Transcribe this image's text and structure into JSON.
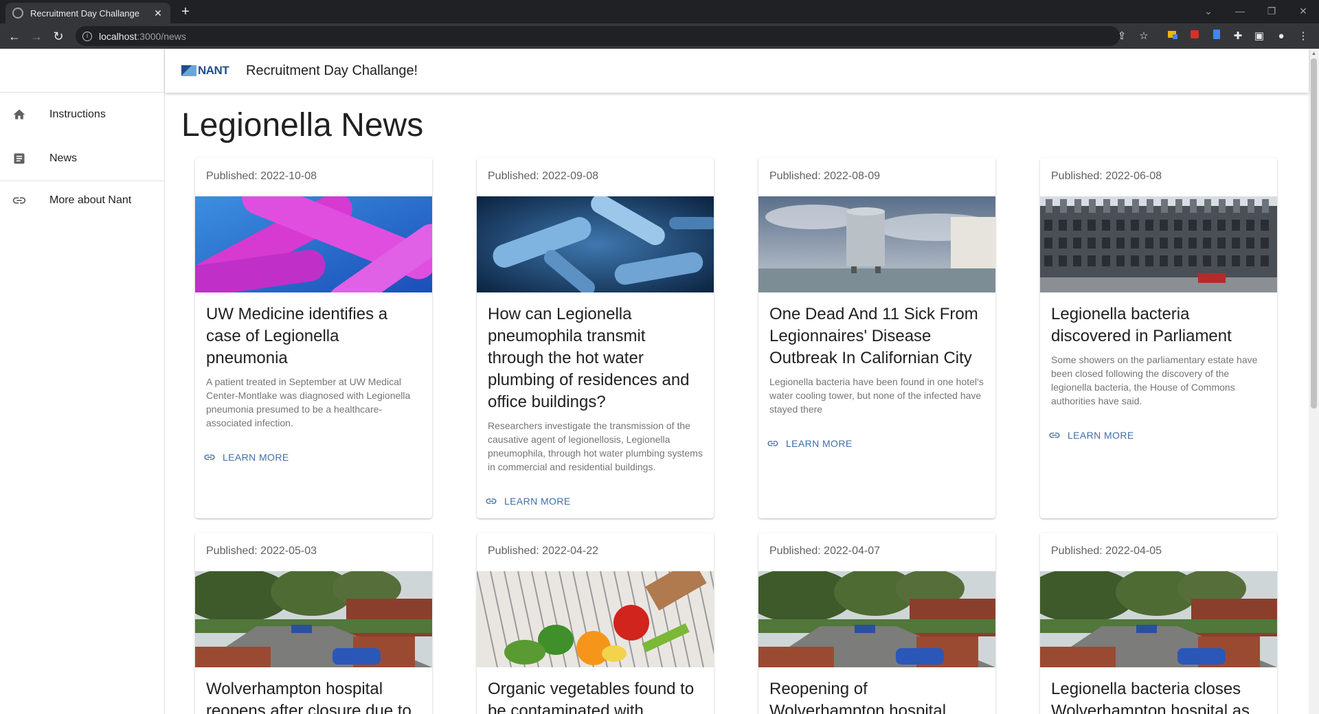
{
  "browser": {
    "tab_title": "Recruitment Day Challange",
    "tab_close": "✕",
    "new_tab": "+",
    "url_host": "localhost",
    "url_path": ":3000/news",
    "window_controls": [
      "⌄",
      "—",
      "❐",
      "✕"
    ]
  },
  "app": {
    "logo_text": "NANT",
    "title": "Recruitment Day Challange!"
  },
  "sidebar": {
    "items": [
      {
        "label": "Instructions",
        "icon": "home-icon"
      },
      {
        "label": "News",
        "icon": "article-icon"
      },
      {
        "label": "More about Nant",
        "icon": "link-icon"
      }
    ]
  },
  "page": {
    "title": "Legionella News",
    "learn_more": "LEARN MORE"
  },
  "cards": [
    {
      "published": "Published: 2022-10-08",
      "title": "UW Medicine identifies a case of Legionella pneumonia",
      "description": "A patient treated in September at UW Medical Center-Montlake was diagnosed with Legionella pneumonia presumed to be a healthcare-associated infection.",
      "image": "bacteria-magenta"
    },
    {
      "published": "Published: 2022-09-08",
      "title": "How can Legionella pneumophila transmit through the hot water plumbing of residences and office buildings?",
      "description": "Researchers investigate the transmission of the causative agent of legionellosis, Legionella pneumophila, through hot water plumbing systems in commercial and residential buildings.",
      "image": "bacteria-blue"
    },
    {
      "published": "Published: 2022-08-09",
      "title": "One Dead And 11 Sick From Legionnaires' Disease Outbreak In Californian City",
      "description": "Legionella bacteria have been found in one hotel's water cooling tower, but none of the infected have stayed there",
      "image": "water-tank"
    },
    {
      "published": "Published: 2022-06-08",
      "title": "Legionella bacteria discovered in Parliament",
      "description": "Some showers on the parliamentary estate have been closed following the discovery of the legionella bacteria, the House of Commons authorities have said.",
      "image": "parliament-building"
    },
    {
      "published": "Published: 2022-05-03",
      "title": "Wolverhampton hospital reopens after closure due to",
      "description": "",
      "image": "hospital"
    },
    {
      "published": "Published: 2022-04-22",
      "title": "Organic vegetables found to be contaminated with",
      "description": "",
      "image": "vegetables-cart"
    },
    {
      "published": "Published: 2022-04-07",
      "title": "Reopening of Wolverhampton hospital",
      "description": "",
      "image": "hospital"
    },
    {
      "published": "Published: 2022-04-05",
      "title": "Legionella bacteria closes Wolverhampton hospital as",
      "description": "",
      "image": "hospital"
    }
  ]
}
